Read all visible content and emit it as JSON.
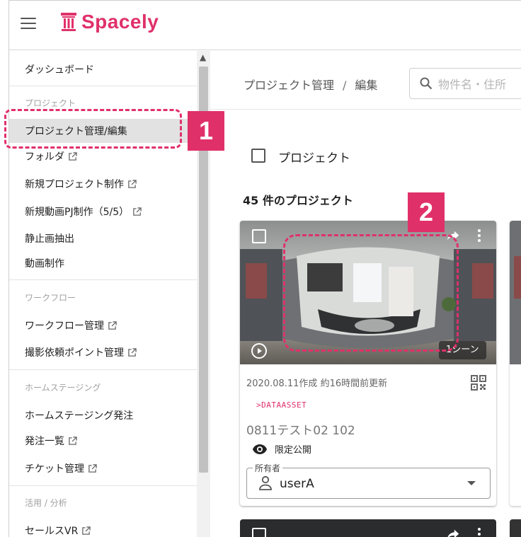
{
  "header": {
    "logo_text": "Spacely"
  },
  "sidebar": {
    "items": [
      {
        "label": "ダッシュボード",
        "external": false
      },
      {
        "label": "プロジェクト管理/編集",
        "external": false,
        "active": true
      },
      {
        "label": "フォルダ",
        "external": true
      },
      {
        "label": "新規プロジェクト制作",
        "external": true
      },
      {
        "label": "新規動画PJ制作（5/5）",
        "external": true
      },
      {
        "label": "静止画抽出",
        "external": false
      },
      {
        "label": "動画制作",
        "external": false
      },
      {
        "label": "ワークフロー管理",
        "external": true
      },
      {
        "label": "撮影依頼ポイント管理",
        "external": true
      },
      {
        "label": "ホームステージング発注",
        "external": false
      },
      {
        "label": "発注一覧",
        "external": true
      },
      {
        "label": "チケット管理",
        "external": true
      },
      {
        "label": "セールスVR",
        "external": true
      }
    ],
    "sections": {
      "project": "プロジェクト",
      "workflow": "ワークフロー",
      "home_staging": "ホームステージング",
      "analytics": "活用 / 分析"
    }
  },
  "main": {
    "breadcrumb": [
      "プロジェクト管理",
      "/",
      "編集"
    ],
    "search_placeholder": "物件名・住所",
    "select_all_label": "プロジェクト",
    "count_label": "45 件のプロジェクト",
    "card": {
      "scene_badge": "1シーン",
      "date": "2020.08.11作成 約16時間前更新",
      "tag": ">DATAASSET",
      "name": "0811テスト02 102",
      "visibility": "限定公開",
      "owner_label": "所有者",
      "owner_value": "userA"
    }
  },
  "annotations": {
    "step1": "1",
    "step2": "2"
  },
  "colors": {
    "brand": "#e0306a",
    "active_nav_bg": "#e2e2e2"
  }
}
